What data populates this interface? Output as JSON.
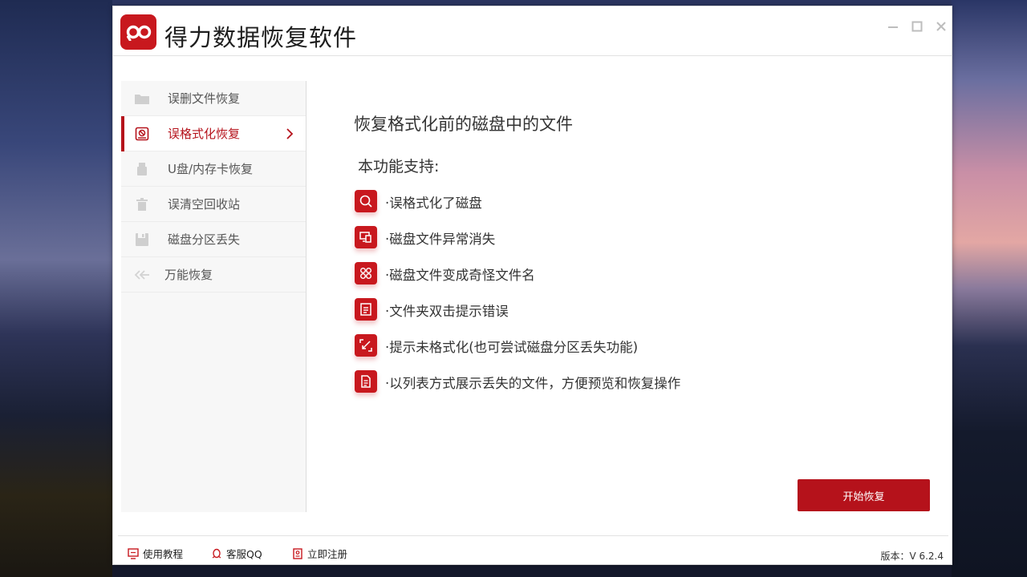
{
  "app": {
    "title": "得力数据恢复软件"
  },
  "window_controls": {
    "minimize_icon": "minimize-icon",
    "maximize_icon": "maximize-icon",
    "close_icon": "close-icon"
  },
  "sidebar": {
    "items": [
      {
        "label": "误删文件恢复",
        "icon": "folder-icon",
        "active": false
      },
      {
        "label": "误格式化恢复",
        "icon": "format-disk-icon",
        "active": true
      },
      {
        "label": "U盘/内存卡恢复",
        "icon": "usb-drive-icon",
        "active": false
      },
      {
        "label": "误清空回收站",
        "icon": "trash-icon",
        "active": false
      },
      {
        "label": "磁盘分区丢失",
        "icon": "disk-partition-icon",
        "active": false
      },
      {
        "label": "万能恢复",
        "icon": "universal-recover-icon",
        "active": false
      }
    ]
  },
  "main": {
    "title": "恢复格式化前的磁盘中的文件",
    "support_heading": "本功能支持:",
    "features": [
      {
        "text": "·误格式化了磁盘",
        "icon": "search-icon"
      },
      {
        "text": "·磁盘文件异常消失",
        "icon": "devices-icon"
      },
      {
        "text": "·磁盘文件变成奇怪文件名",
        "icon": "command-icon"
      },
      {
        "text": "·文件夹双击提示错误",
        "icon": "document-list-icon"
      },
      {
        "text": "·提示未格式化(也可尝试磁盘分区丢失功能)",
        "icon": "shrink-arrows-icon"
      },
      {
        "text": "·以列表方式展示丢失的文件，方便预览和恢复操作",
        "icon": "file-text-icon"
      }
    ],
    "start_button": "开始恢复"
  },
  "footer": {
    "tutorial": "使用教程",
    "support_qq": "客服QQ",
    "register": "立即注册",
    "version": "版本：V 6.2.4"
  },
  "colors": {
    "brand_red": "#c8181e",
    "active_red": "#b5121b"
  }
}
